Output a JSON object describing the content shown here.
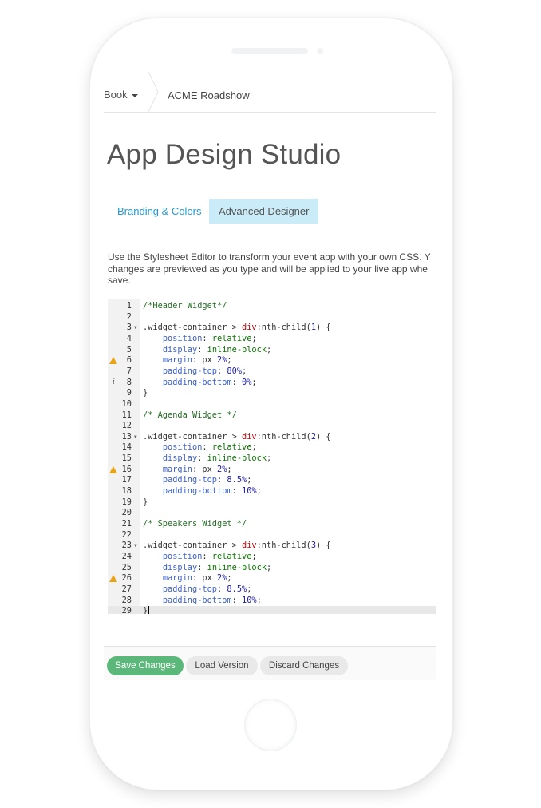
{
  "breadcrumb": {
    "book": "Book",
    "event": "ACME Roadshow"
  },
  "page": {
    "title": "App Design Studio"
  },
  "tabs": [
    {
      "label": "Branding & Colors",
      "active": false
    },
    {
      "label": "Advanced Designer",
      "active": true
    }
  ],
  "description": {
    "line1": "Use the Stylesheet Editor to transform your event app with your own CSS. Y",
    "line2": "changes are previewed as you type and will be applied to your live app whe",
    "line3": "save."
  },
  "editor": {
    "lines": [
      {
        "n": "1",
        "marker": "",
        "fold": false,
        "segs": [
          [
            "c-comment",
            "/*Header Widget*/"
          ]
        ]
      },
      {
        "n": "2",
        "marker": "",
        "fold": false,
        "segs": []
      },
      {
        "n": "3",
        "marker": "",
        "fold": true,
        "segs": [
          [
            "c-sel",
            ".widget-container > "
          ],
          [
            "c-tag",
            "div"
          ],
          [
            "c-sel",
            ":nth-child("
          ],
          [
            "c-val",
            "1"
          ],
          [
            "c-sel",
            ") {"
          ]
        ]
      },
      {
        "n": "4",
        "marker": "",
        "fold": false,
        "segs": [
          [
            "c-sel",
            "    "
          ],
          [
            "c-prop",
            "position"
          ],
          [
            "c-sel",
            ": "
          ],
          [
            "c-kw",
            "relative"
          ],
          [
            "c-sel",
            ";"
          ]
        ]
      },
      {
        "n": "5",
        "marker": "",
        "fold": false,
        "segs": [
          [
            "c-sel",
            "    "
          ],
          [
            "c-prop",
            "display"
          ],
          [
            "c-sel",
            ": "
          ],
          [
            "c-kw",
            "inline-block"
          ],
          [
            "c-sel",
            ";"
          ]
        ]
      },
      {
        "n": "6",
        "marker": "warning",
        "fold": false,
        "segs": [
          [
            "c-sel",
            "    "
          ],
          [
            "c-prop",
            "margin"
          ],
          [
            "c-sel",
            ": px "
          ],
          [
            "c-val",
            "2%"
          ],
          [
            "c-sel",
            ";"
          ]
        ]
      },
      {
        "n": "7",
        "marker": "",
        "fold": false,
        "segs": [
          [
            "c-sel",
            "    "
          ],
          [
            "c-prop",
            "padding-top"
          ],
          [
            "c-sel",
            ": "
          ],
          [
            "c-val",
            "80%"
          ],
          [
            "c-sel",
            ";"
          ]
        ]
      },
      {
        "n": "8",
        "marker": "info",
        "fold": false,
        "segs": [
          [
            "c-sel",
            "    "
          ],
          [
            "c-prop",
            "padding-bottom"
          ],
          [
            "c-sel",
            ": "
          ],
          [
            "c-val",
            "0%"
          ],
          [
            "c-sel",
            ";"
          ]
        ]
      },
      {
        "n": "9",
        "marker": "",
        "fold": false,
        "segs": [
          [
            "c-sel",
            "}"
          ]
        ]
      },
      {
        "n": "10",
        "marker": "",
        "fold": false,
        "segs": []
      },
      {
        "n": "11",
        "marker": "",
        "fold": false,
        "segs": [
          [
            "c-comment",
            "/* Agenda Widget */"
          ]
        ]
      },
      {
        "n": "12",
        "marker": "",
        "fold": false,
        "segs": []
      },
      {
        "n": "13",
        "marker": "",
        "fold": true,
        "segs": [
          [
            "c-sel",
            ".widget-container > "
          ],
          [
            "c-tag",
            "div"
          ],
          [
            "c-sel",
            ":nth-child("
          ],
          [
            "c-val",
            "2"
          ],
          [
            "c-sel",
            ") {"
          ]
        ]
      },
      {
        "n": "14",
        "marker": "",
        "fold": false,
        "segs": [
          [
            "c-sel",
            "    "
          ],
          [
            "c-prop",
            "position"
          ],
          [
            "c-sel",
            ": "
          ],
          [
            "c-kw",
            "relative"
          ],
          [
            "c-sel",
            ";"
          ]
        ]
      },
      {
        "n": "15",
        "marker": "",
        "fold": false,
        "segs": [
          [
            "c-sel",
            "    "
          ],
          [
            "c-prop",
            "display"
          ],
          [
            "c-sel",
            ": "
          ],
          [
            "c-kw",
            "inline-block"
          ],
          [
            "c-sel",
            ";"
          ]
        ]
      },
      {
        "n": "16",
        "marker": "warning",
        "fold": false,
        "segs": [
          [
            "c-sel",
            "    "
          ],
          [
            "c-prop",
            "margin"
          ],
          [
            "c-sel",
            ": px "
          ],
          [
            "c-val",
            "2%"
          ],
          [
            "c-sel",
            ";"
          ]
        ]
      },
      {
        "n": "17",
        "marker": "",
        "fold": false,
        "segs": [
          [
            "c-sel",
            "    "
          ],
          [
            "c-prop",
            "padding-top"
          ],
          [
            "c-sel",
            ": "
          ],
          [
            "c-val",
            "8.5%"
          ],
          [
            "c-sel",
            ";"
          ]
        ]
      },
      {
        "n": "18",
        "marker": "",
        "fold": false,
        "segs": [
          [
            "c-sel",
            "    "
          ],
          [
            "c-prop",
            "padding-bottom"
          ],
          [
            "c-sel",
            ": "
          ],
          [
            "c-val",
            "10%"
          ],
          [
            "c-sel",
            ";"
          ]
        ]
      },
      {
        "n": "19",
        "marker": "",
        "fold": false,
        "segs": [
          [
            "c-sel",
            "}"
          ]
        ]
      },
      {
        "n": "20",
        "marker": "",
        "fold": false,
        "segs": []
      },
      {
        "n": "21",
        "marker": "",
        "fold": false,
        "segs": [
          [
            "c-comment",
            "/* Speakers Widget */"
          ]
        ]
      },
      {
        "n": "22",
        "marker": "",
        "fold": false,
        "segs": []
      },
      {
        "n": "23",
        "marker": "",
        "fold": true,
        "segs": [
          [
            "c-sel",
            ".widget-container > "
          ],
          [
            "c-tag",
            "div"
          ],
          [
            "c-sel",
            ":nth-child("
          ],
          [
            "c-val",
            "3"
          ],
          [
            "c-sel",
            ") {"
          ]
        ]
      },
      {
        "n": "24",
        "marker": "",
        "fold": false,
        "segs": [
          [
            "c-sel",
            "    "
          ],
          [
            "c-prop",
            "position"
          ],
          [
            "c-sel",
            ": "
          ],
          [
            "c-kw",
            "relative"
          ],
          [
            "c-sel",
            ";"
          ]
        ]
      },
      {
        "n": "25",
        "marker": "",
        "fold": false,
        "segs": [
          [
            "c-sel",
            "    "
          ],
          [
            "c-prop",
            "display"
          ],
          [
            "c-sel",
            ": "
          ],
          [
            "c-kw",
            "inline-block"
          ],
          [
            "c-sel",
            ";"
          ]
        ]
      },
      {
        "n": "26",
        "marker": "warning",
        "fold": false,
        "segs": [
          [
            "c-sel",
            "    "
          ],
          [
            "c-prop",
            "margin"
          ],
          [
            "c-sel",
            ": px "
          ],
          [
            "c-val",
            "2%"
          ],
          [
            "c-sel",
            ";"
          ]
        ]
      },
      {
        "n": "27",
        "marker": "",
        "fold": false,
        "segs": [
          [
            "c-sel",
            "    "
          ],
          [
            "c-prop",
            "padding-top"
          ],
          [
            "c-sel",
            ": "
          ],
          [
            "c-val",
            "8.5%"
          ],
          [
            "c-sel",
            ";"
          ]
        ]
      },
      {
        "n": "28",
        "marker": "",
        "fold": false,
        "segs": [
          [
            "c-sel",
            "    "
          ],
          [
            "c-prop",
            "padding-bottom"
          ],
          [
            "c-sel",
            ": "
          ],
          [
            "c-val",
            "10%"
          ],
          [
            "c-sel",
            ";"
          ]
        ]
      },
      {
        "n": "29",
        "marker": "",
        "fold": false,
        "active": true,
        "segs": [
          [
            "c-sel",
            "}"
          ]
        ]
      }
    ]
  },
  "actions": {
    "save": "Save Changes",
    "load": "Load Version",
    "discard": "Discard Changes"
  },
  "colors": {
    "accent": "#2a98c8",
    "active_tab_bg": "#c9ecf8",
    "save_button": "#5cb87a",
    "warning": "#e8a317"
  }
}
